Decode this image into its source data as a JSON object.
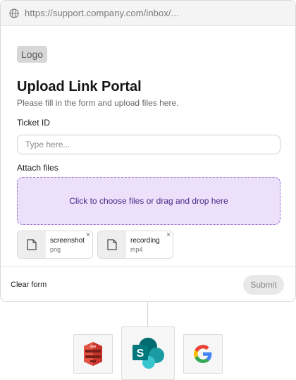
{
  "browser": {
    "url": "https://support.company.com/inbox/...",
    "globe_icon": "globe-icon"
  },
  "form": {
    "logo_text": "Logo",
    "title": "Upload Link Portal",
    "subtitle": "Please fill in the form and upload files here.",
    "ticket_label": "Ticket ID",
    "ticket_placeholder": "Type here...",
    "ticket_value": "",
    "attach_label": "Attach files",
    "dropzone_text": "Click to choose files or drag and drop here",
    "files": [
      {
        "name": "screenshot",
        "type": "png",
        "icon": "file-icon",
        "remove_label": "×"
      },
      {
        "name": "recording",
        "type": "mp4",
        "icon": "file-icon",
        "remove_label": "×"
      }
    ]
  },
  "footer": {
    "clear_label": "Clear form",
    "submit_label": "Submit"
  },
  "integrations": [
    {
      "name": "AWS S3",
      "icon": "aws-s3-icon",
      "color": "#c7342b"
    },
    {
      "name": "SharePoint",
      "icon": "sharepoint-icon",
      "color": "#0b7a7f"
    },
    {
      "name": "Google",
      "icon": "google-icon",
      "color": "#4285f4"
    }
  ],
  "colors": {
    "dropzone_bg": "#ece0fb",
    "dropzone_border": "#9b6fd6",
    "dropzone_text": "#4c2a8a"
  }
}
